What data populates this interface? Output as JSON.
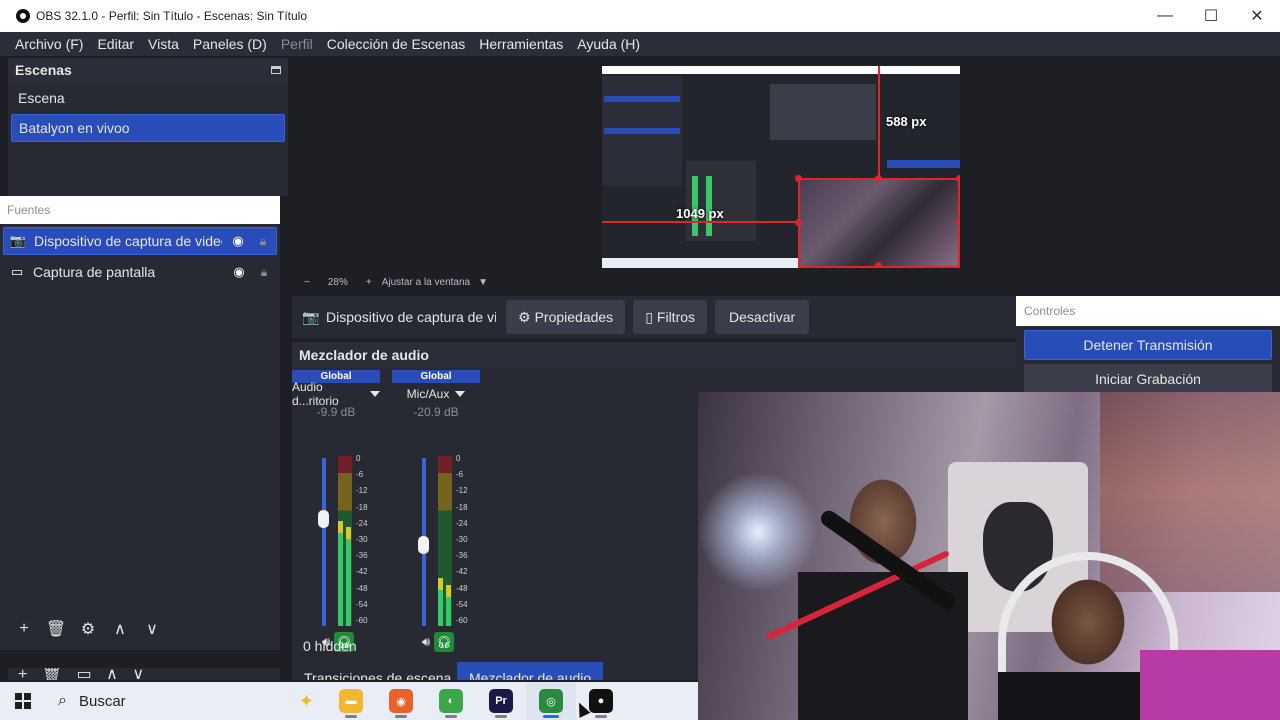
{
  "window": {
    "title": "OBS 32.1.0 - Perfil: Sin Título - Escenas: Sin Título",
    "minimize": "—",
    "maximize": "☐",
    "close": "✕"
  },
  "menu": {
    "items": [
      "Archivo (F)",
      "Editar",
      "Vista",
      "Paneles (D)",
      "Perfil",
      "Colección de Escenas",
      "Herramientas",
      "Ayuda (H)"
    ]
  },
  "scenes": {
    "header": "Escenas",
    "items": [
      {
        "label": "Escena"
      },
      {
        "label": "Batalyon en vivoo"
      }
    ]
  },
  "sources": {
    "header": "Fuentes",
    "items": [
      {
        "label": "Dispositivo de captura de video"
      },
      {
        "label": "Captura de pantalla"
      }
    ],
    "toolbar": [
      "+",
      "🗑",
      "⚙",
      "∧",
      "∨"
    ]
  },
  "scene_toolbar_peek": [
    "+",
    "🗑",
    "▭",
    "∧",
    "∨"
  ],
  "preview": {
    "label_vertical": "588 px",
    "label_horizontal": "1049 px"
  },
  "zoom": {
    "minus": "−",
    "level": "28%",
    "plus": "+",
    "fit": "Ajustar a la ventana"
  },
  "source_toolbar": {
    "title": "Dispositivo de captura de video",
    "properties": "Propiedades",
    "filters": "Filtros",
    "deactivate": "Desactivar"
  },
  "mixer": {
    "header": "Mezclador de audio",
    "channels": [
      {
        "global": "Global",
        "name": "Audio d...ritorio",
        "db": "-9.9 dB",
        "volume": 0.62,
        "level_l": 0.62,
        "level_r": 0.58
      },
      {
        "global": "Global",
        "name": "Mic/Aux",
        "db": "-20.9 dB",
        "volume": 0.48,
        "level_l": 0.28,
        "level_r": 0.24
      }
    ],
    "scale": [
      "0",
      "-6",
      "-12",
      "-18",
      "-24",
      "-30",
      "-36",
      "-42",
      "-48",
      "-54",
      "-60"
    ],
    "hidden": "0 hidden"
  },
  "tabs": [
    "Transiciones de escena",
    "Mezclador de audio"
  ],
  "controls": {
    "header": "Controles",
    "stop_stream": "Detener Transmisión",
    "start_record": "Iniciar Grabación"
  },
  "taskbar": {
    "search": "Buscar",
    "apps": [
      {
        "name": "file-explorer",
        "glyph": "▬",
        "color": "#f2b632"
      },
      {
        "name": "firefox",
        "glyph": "◉",
        "color": "#e8622c"
      },
      {
        "name": "app-green",
        "glyph": "◐",
        "color": "#3aa84a"
      },
      {
        "name": "premiere-pro",
        "glyph": "Pr",
        "color": "#1b1a47"
      },
      {
        "name": "chrome",
        "glyph": "◎",
        "color": "#2b8a3e"
      },
      {
        "name": "obs",
        "glyph": "●",
        "color": "#111111"
      }
    ]
  }
}
